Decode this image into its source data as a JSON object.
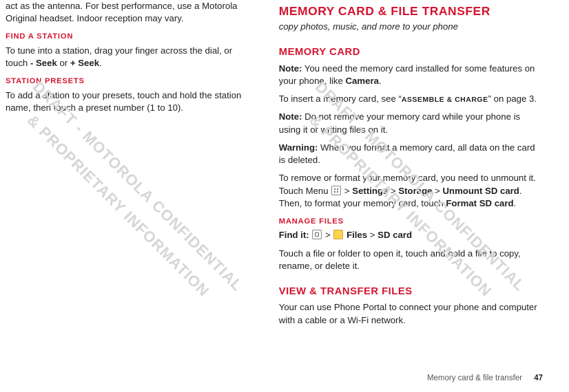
{
  "watermark": "DRAFT - MOTOROLA CONFIDENTIAL\n& PROPRIETARY INFORMATION",
  "left": {
    "intro": "act as the antenna. For best performance, use a Motorola Original headset. Indoor reception may vary.",
    "h_find": "FIND A STATION",
    "find_body_pre": "To tune into a station, drag your finger across the dial, or touch ",
    "find_body_b1": "- Seek",
    "find_body_mid": " or ",
    "find_body_b2": "+ Seek",
    "find_body_end": ".",
    "h_presets": "STATION PRESETS",
    "presets_body": "To add a station to your presets, touch and hold the station name, then touch a preset number (1 to 10)."
  },
  "right": {
    "h_main": "MEMORY CARD & FILE TRANSFER",
    "subtitle": "copy photos, music, and more to your phone",
    "h_memcard": "MEMORY CARD",
    "note1_pre": "Note:",
    "note1_body_a": " You need the memory card installed for some features on your phone, like ",
    "note1_body_b": "Camera",
    "note1_body_end": ".",
    "insert_pre": "To insert a memory card, see “",
    "insert_sc": "ASSEMBLE & CHARGE",
    "insert_post": "” on page 3.",
    "note2_pre": "Note:",
    "note2_body": " Do not remove your memory card while your phone is using it or writing files on it.",
    "warn_pre": "Warning:",
    "warn_body": " When you format a memory card, all data on the card is deleted.",
    "remove_a": "To remove or format your memory card, you need to unmount it. Touch Menu ",
    "remove_b": " > ",
    "remove_c": "Settings",
    "remove_d": " > ",
    "remove_e": "Storage",
    "remove_f": " > ",
    "remove_g": "Unmount SD card",
    "remove_h": ". Then, to format your memory card, touch ",
    "remove_i": "Format SD card",
    "remove_end": ".",
    "h_manage": "MANAGE FILES",
    "findit_pre": "Find it:",
    "findit_a": " ",
    "findit_b": " > ",
    "findit_files": " Files",
    "findit_c": " > ",
    "findit_sd": "SD card",
    "manage_body": "Touch a file or folder to open it, touch and hold a file to copy, rename, or delete it.",
    "h_view": "VIEW & TRANSFER FILES",
    "view_body": "Your can use Phone Portal to connect your phone and computer with a cable or a Wi-Fi network."
  },
  "footer": {
    "section": "Memory card & file transfer",
    "page": "47"
  }
}
